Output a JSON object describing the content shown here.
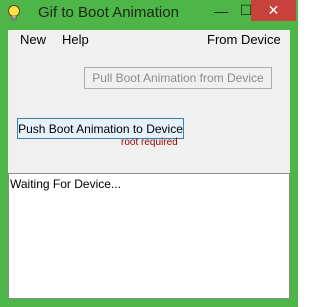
{
  "window": {
    "title": "Gif to Boot Animation",
    "controls": {
      "minimize_glyph": "—",
      "maximize_glyph": "☐",
      "close_glyph": "✕"
    }
  },
  "menu": {
    "new": "New",
    "help": "Help",
    "from_device": "From Device"
  },
  "buttons": {
    "pull": "Pull Boot Animation from Device",
    "push": "Push Boot Animation to Device"
  },
  "note": "root required",
  "log": {
    "text": "Waiting For Device..."
  },
  "colors": {
    "titlebar": "#4eb548",
    "close": "#c7423a",
    "warning_text": "#990000"
  },
  "icons": {
    "app": "lightbulb-icon"
  }
}
